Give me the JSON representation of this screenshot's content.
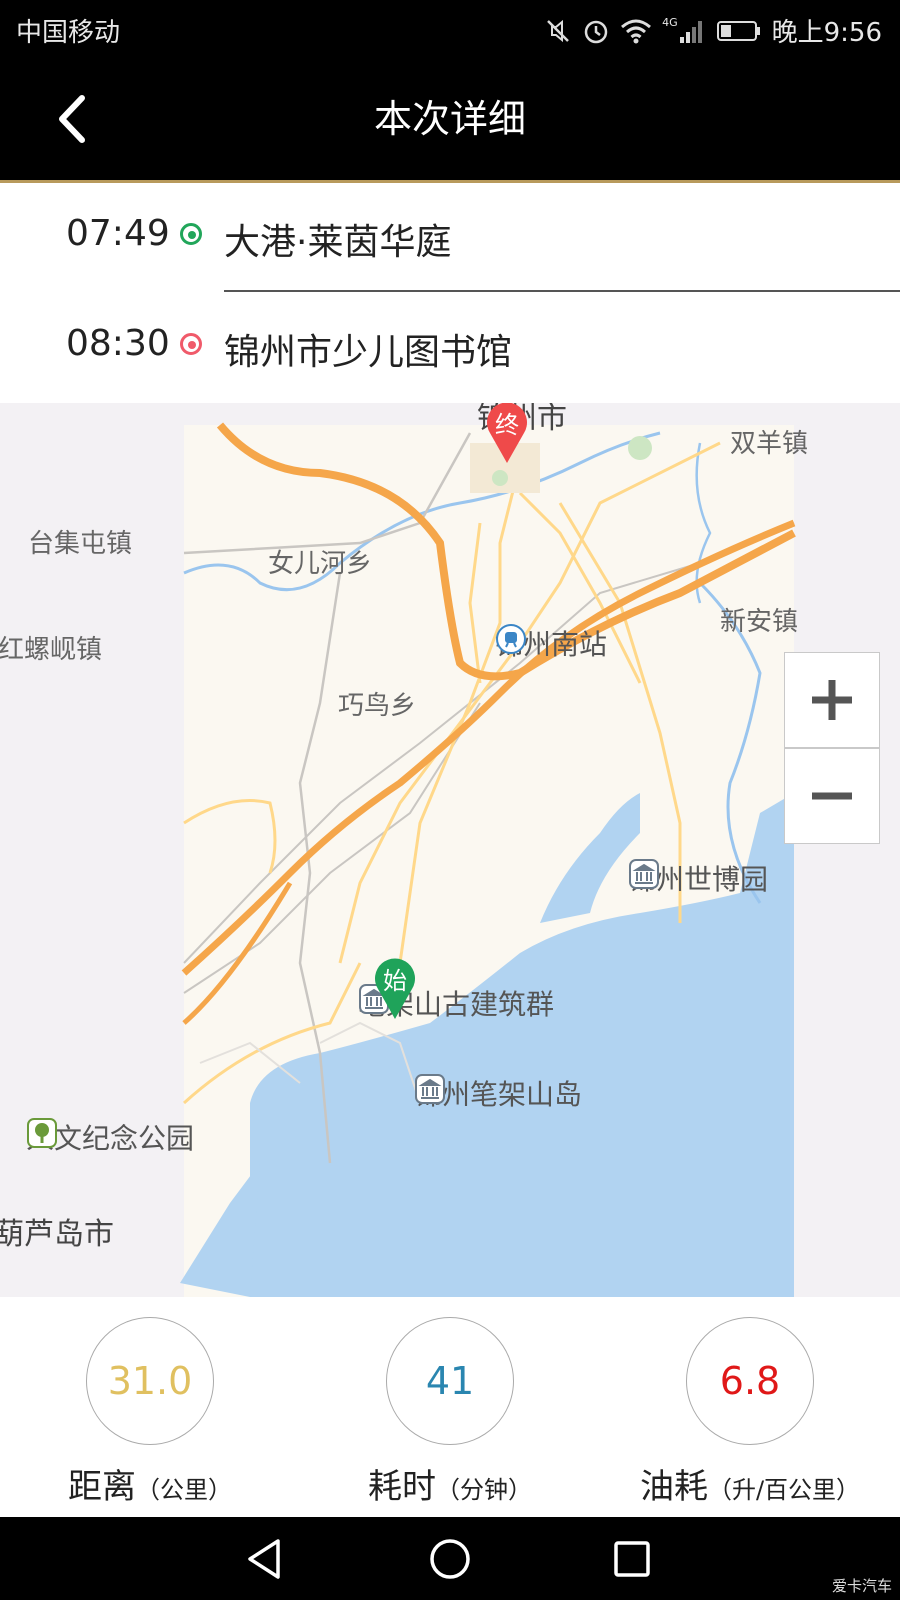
{
  "status_bar": {
    "carrier": "中国移动",
    "network": "4G",
    "time": "晚上9:56",
    "icons": [
      "mute-icon",
      "alarm-icon",
      "wifi-icon",
      "signal-icon",
      "battery-icon"
    ]
  },
  "header": {
    "title": "本次详细",
    "back_icon": "chevron-left-icon"
  },
  "route": {
    "start": {
      "time": "07:49",
      "place": "大港·莱茵华庭",
      "color": "#21a65a"
    },
    "end": {
      "time": "08:30",
      "place": "锦州市少儿图书馆",
      "color": "#f05a6a"
    }
  },
  "map": {
    "labels": {
      "jinzhou_city": "锦州市",
      "shuangyang": "双羊镇",
      "taijitun": "台集屯镇",
      "nverhe": "女儿河乡",
      "hongluoxian": "红螺岘镇",
      "xinan": "新安镇",
      "qiaoniao": "巧鸟乡",
      "huludao": "葫芦岛市"
    },
    "pois": {
      "south_station": "锦州南站",
      "expo": "锦州世博园",
      "bijiashan_ancient": "笔架山古建筑群",
      "bijiashan_island": "锦州笔架山岛",
      "renwen_park": "人文纪念公园"
    },
    "markers": {
      "end": "终",
      "start": "始"
    },
    "zoom_in": "+",
    "zoom_out": "−",
    "colors": {
      "land": "#fbf8f1",
      "water": "#b1d3f1",
      "highway": "#f5a64a",
      "road": "#ffd88a"
    }
  },
  "stats": {
    "distance": {
      "value": "31.0",
      "label": "距离",
      "unit": "（公里）",
      "color": "#e0c060"
    },
    "duration": {
      "value": "41",
      "label": "耗时",
      "unit": "（分钟）",
      "color": "#2a86b0"
    },
    "fuel": {
      "value": "6.8",
      "label": "油耗",
      "unit": "（升/百公里）",
      "color": "#e01818"
    }
  },
  "nav_bar": {
    "icons": [
      "back-triangle-icon",
      "home-circle-icon",
      "recents-square-icon"
    ]
  },
  "watermark": "爱卡汽车"
}
